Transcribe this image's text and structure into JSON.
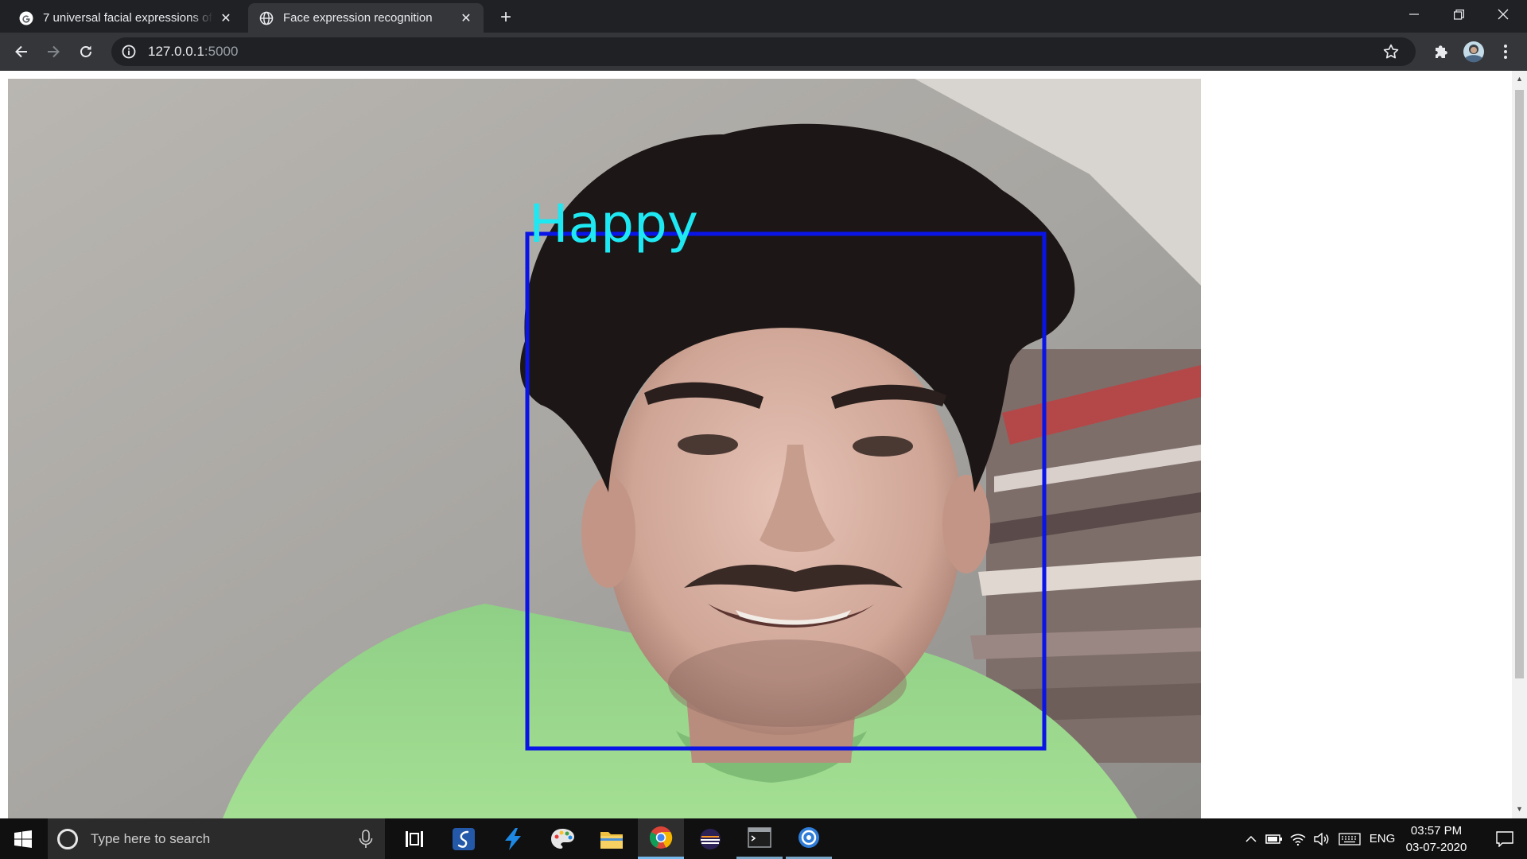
{
  "browser": {
    "tabs": [
      {
        "title": "7 universal facial expressions of e",
        "favicon": "google-g-icon",
        "active": false
      },
      {
        "title": "Face expression recognition",
        "favicon": "globe-icon",
        "active": true
      }
    ],
    "address": {
      "host": "127.0.0.1",
      "port": ":5000"
    },
    "icons": {
      "back": "arrow-left-icon",
      "forward": "arrow-right-icon",
      "reload": "reload-icon",
      "site_info": "info-icon",
      "bookmark": "star-icon",
      "extensions": "puzzle-icon",
      "profile": "avatar",
      "menu": "kebab-menu-icon"
    }
  },
  "page": {
    "video": {
      "detection_label": "Happy",
      "label_color": "#1ee8f2",
      "box_color": "#0a14e6"
    }
  },
  "taskbar": {
    "search_placeholder": "Type here to search",
    "language": "ENG",
    "time": "03:57 PM",
    "date": "03-07-2020",
    "accent_color": "#76b9ed"
  }
}
